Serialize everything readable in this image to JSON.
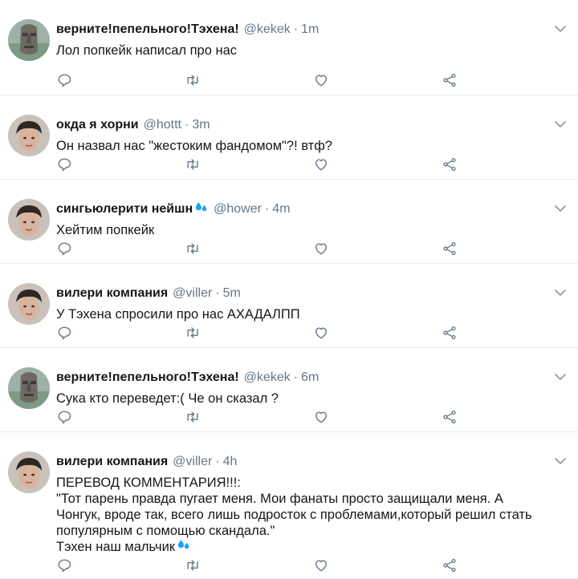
{
  "tweets": [
    {
      "avatar": "moai-avatar",
      "name": "верните!пепельного!Тэхена!",
      "has_drop": false,
      "handle": "@kekek",
      "time": "1m",
      "lines": [
        "Лол попкейк написал про нас"
      ]
    },
    {
      "avatar": "person-avatar",
      "name": "окда я хорни",
      "has_drop": false,
      "handle": "@hottt",
      "time": "3m",
      "lines": [
        "Он назвал нас \"жестоким фандомом\"?! втф?"
      ]
    },
    {
      "avatar": "person-avatar",
      "name": "сингьюлерити нейшн",
      "has_drop": true,
      "handle": "@hower",
      "time": "4m",
      "lines": [
        "Хейтим попкейк"
      ]
    },
    {
      "avatar": "person-avatar",
      "name": "вилери компания",
      "has_drop": false,
      "handle": "@viller",
      "time": "5m",
      "lines": [
        "У Тэхена спросили про нас АХАДАЛПП"
      ]
    },
    {
      "avatar": "moai-avatar",
      "name": "верните!пепельного!Тэхена!",
      "has_drop": false,
      "handle": "@kekek",
      "time": "6m",
      "lines": [
        "Сука кто переведет:( Че он сказал ?"
      ]
    },
    {
      "avatar": "person-avatar",
      "name": "вилери компания",
      "has_drop": false,
      "handle": "@viller",
      "time": "4h",
      "lines": [
        "ПЕРЕВОД КОММЕНТАРИЯ!!!:",
        "\"Тот парень правда пугает меня. Мои фанаты просто защищали меня. А",
        "Чонгук, вроде так, всего лишь подросток с проблемами,который решил стать",
        "популярным с помощью скандала.\"",
        "Тэхен наш мальчик"
      ],
      "last_line_drop": true
    }
  ],
  "colors": {
    "text": "#14171a",
    "secondary": "#657786",
    "divider": "#e6ecf0",
    "drop": "#1da1f2"
  },
  "icons": [
    "reply-icon",
    "retweet-icon",
    "like-icon",
    "share-icon",
    "chevron-down-icon",
    "droplet-icon"
  ]
}
